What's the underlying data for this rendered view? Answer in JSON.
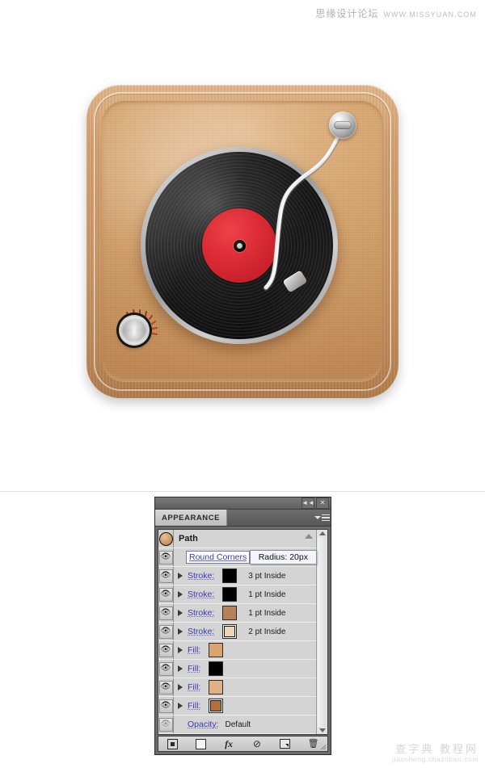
{
  "watermarks": {
    "top_cn": "思缘设计论坛",
    "top_url": "WWW.MISSYUAN.COM",
    "bottom_cn": "查字典 教程网",
    "bottom_url": "jiaocheng.chazidian.com"
  },
  "illustration": {
    "name": "vintage-turntable-icon",
    "colors": {
      "wood_light": "#e0b686",
      "wood_mid": "#cb9761",
      "wood_dark": "#b07c4c",
      "record_black": "#101010",
      "label_red": "#d32b35",
      "metal_silver": "#c3c3c3"
    }
  },
  "panel": {
    "titlebar": {
      "collapse_label": "◄◄",
      "close_label": "✕"
    },
    "tab_label": "APPEARANCE",
    "menu_icon": "panel-menu-icon",
    "header_row": {
      "thumbnail": "path-thumbnail",
      "title": "Path"
    },
    "tooltip": {
      "text": "Radius: 20px"
    },
    "rows": [
      {
        "id": "round-corners",
        "label": "Round Corners",
        "value": "",
        "swatch": null,
        "has_disclosure": false,
        "selected": true,
        "eye": true
      },
      {
        "id": "stroke-1",
        "label": "Stroke:",
        "value": "3 pt  Inside",
        "swatch": "#000000",
        "swatch_framed": false,
        "has_disclosure": true,
        "selected": false,
        "eye": true
      },
      {
        "id": "stroke-2",
        "label": "Stroke:",
        "value": "1 pt  Inside",
        "swatch": "#000000",
        "swatch_framed": false,
        "has_disclosure": true,
        "selected": false,
        "eye": true
      },
      {
        "id": "stroke-3",
        "label": "Stroke:",
        "value": "1 pt  Inside",
        "swatch": "#b4835a",
        "swatch_framed": false,
        "has_disclosure": true,
        "selected": false,
        "eye": true
      },
      {
        "id": "stroke-4",
        "label": "Stroke:",
        "value": "2 pt  Inside",
        "swatch": "#ecd6b9",
        "swatch_framed": true,
        "has_disclosure": true,
        "selected": false,
        "eye": true
      },
      {
        "id": "fill-1",
        "label": "Fill:",
        "value": "",
        "swatch": "#d9a46e",
        "swatch_framed": false,
        "has_disclosure": true,
        "selected": false,
        "eye": true
      },
      {
        "id": "fill-2",
        "label": "Fill:",
        "value": "",
        "swatch": "#000000",
        "swatch_framed": false,
        "has_disclosure": true,
        "selected": false,
        "eye": true
      },
      {
        "id": "fill-3",
        "label": "Fill:",
        "value": "",
        "swatch": "#e0b184",
        "swatch_framed": false,
        "has_disclosure": true,
        "selected": false,
        "eye": true
      },
      {
        "id": "fill-4",
        "label": "Fill:",
        "value": "",
        "swatch": "#b4703c",
        "swatch_framed": true,
        "has_disclosure": true,
        "selected": false,
        "eye": true
      },
      {
        "id": "opacity",
        "label": "Opacity:",
        "value": "Default",
        "swatch": null,
        "has_disclosure": false,
        "selected": false,
        "eye": false
      }
    ],
    "footer_buttons": [
      {
        "id": "add-new-stroke",
        "icon": "new-stroke-icon",
        "glyph": ""
      },
      {
        "id": "add-new-fill",
        "icon": "new-fill-icon",
        "glyph": ""
      },
      {
        "id": "add-new-effect",
        "icon": "fx-icon",
        "glyph": "fx"
      },
      {
        "id": "clear-appearance",
        "icon": "clear-appearance-icon",
        "glyph": "⊘"
      },
      {
        "id": "duplicate-item",
        "icon": "duplicate-icon",
        "glyph": ""
      },
      {
        "id": "delete-item",
        "icon": "trash-icon",
        "glyph": "🗑"
      }
    ],
    "scrollbar": {
      "up_arrow": "scroll-up-arrow",
      "down_arrow": "scroll-down-arrow"
    }
  }
}
